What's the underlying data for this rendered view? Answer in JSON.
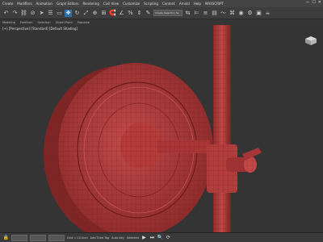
{
  "menus": [
    "Create",
    "Modifiers",
    "Animation",
    "Graph Editors",
    "Rendering",
    "Civil View",
    "Customize",
    "Scripting",
    "Content",
    "Arnold",
    "Help",
    "MAXSCRIPT"
  ],
  "toolbar": {
    "selection_set_placeholder": "Create Selection Se"
  },
  "ribbon": {
    "tabs": [
      "Modeling",
      "Freeform",
      "Selection",
      "Object Paint",
      "Populate"
    ]
  },
  "viewport": {
    "label": "[+] [Perspective] [Standard] [Default Shading]"
  },
  "status": {
    "grid_text": "Grid = 10.0cm",
    "autokey": "Auto Key",
    "selected": "Selected",
    "addtime": "Add Time Tag"
  }
}
